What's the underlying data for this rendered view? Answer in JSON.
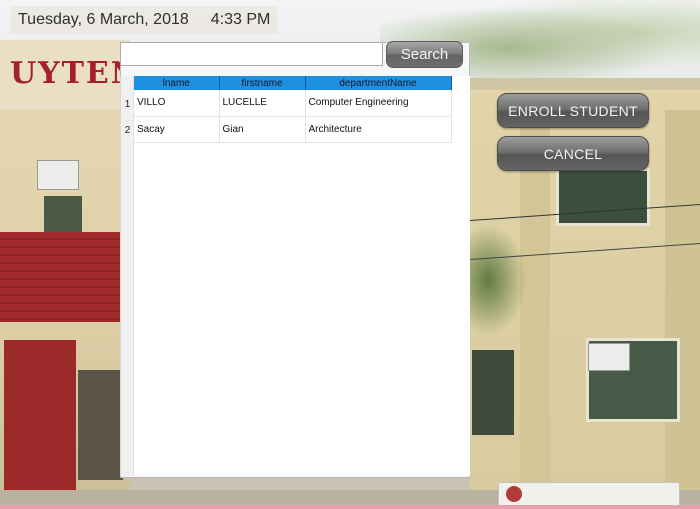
{
  "header": {
    "date": "Tuesday, 6 March, 2018",
    "time": "4:33 PM"
  },
  "background": {
    "sign_text": "UYTENGSU HALL"
  },
  "search": {
    "value": "",
    "button_label": "Search"
  },
  "table": {
    "columns": [
      "lname",
      "firstname",
      "departmentName"
    ],
    "rows": [
      {
        "num": "1",
        "lname": "VILLO",
        "firstname": "LUCELLE",
        "departmentName": "Computer Engineering"
      },
      {
        "num": "2",
        "lname": "Sacay",
        "firstname": "Gian",
        "departmentName": "Architecture"
      }
    ]
  },
  "actions": {
    "enroll_label": "ENROLL STUDENT",
    "cancel_label": "CANCEL"
  },
  "colors": {
    "header_accent": "#1f8fe0",
    "sign_red": "#a4202b"
  }
}
